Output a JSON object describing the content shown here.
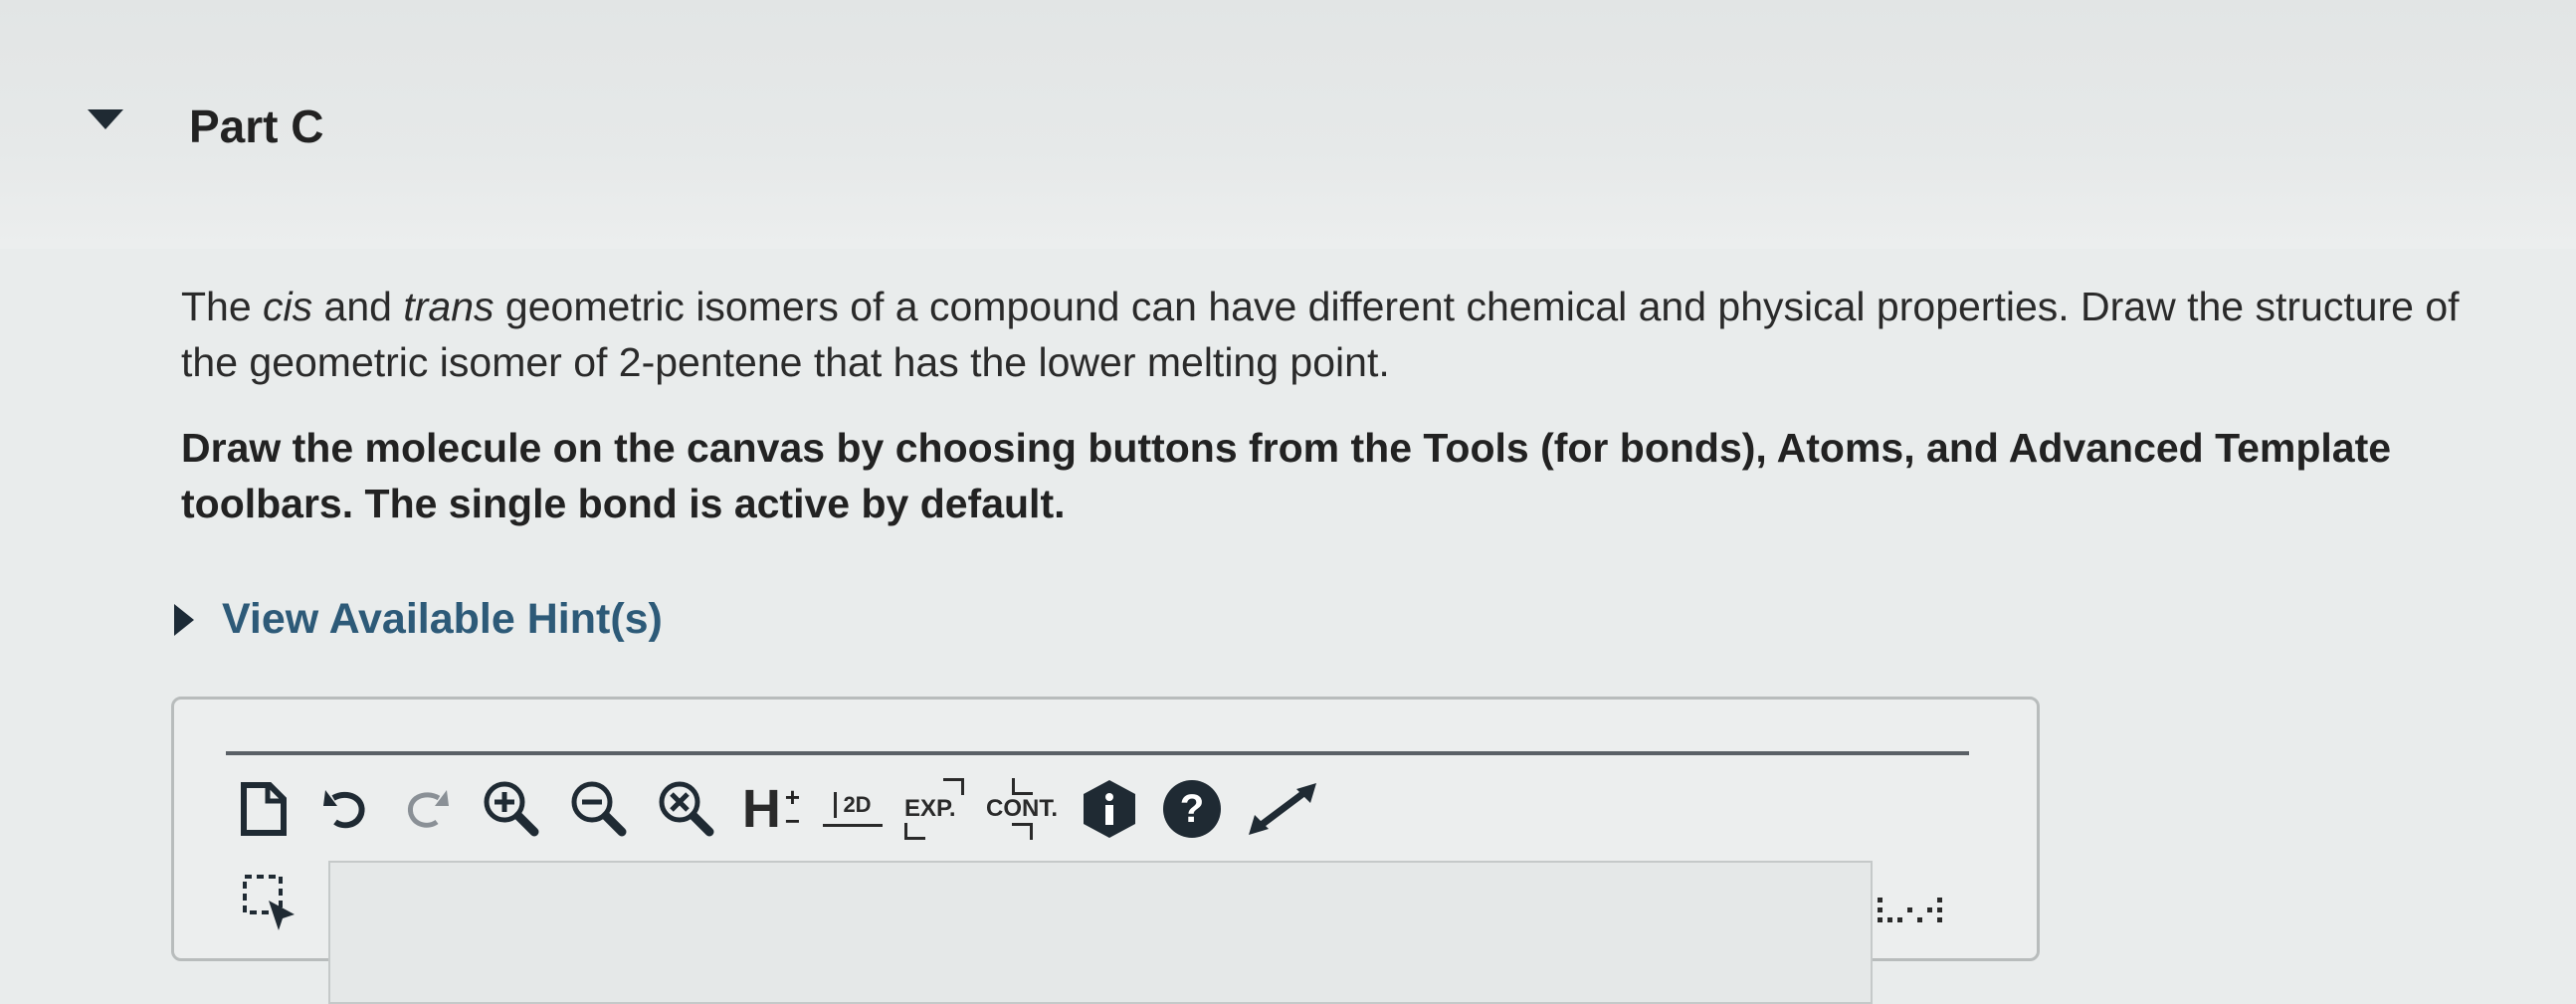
{
  "part": {
    "title": "Part C"
  },
  "question": {
    "p1": "The ",
    "cis": "cis",
    "p2": " and ",
    "trans": "trans",
    "p3": " geometric isomers of a compound can have different chemical and physical properties. Draw the structure of the geometric isomer of 2-pentene that has the lower melting point."
  },
  "instruction": "Draw the molecule on the canvas by choosing buttons from the Tools (for bonds), Atoms, and Advanced Template toolbars. The single bond is active by default.",
  "hint": {
    "label": "View Available Hint(s)"
  },
  "toolbar": {
    "clean_2d_label": "2D",
    "exp_label": "EXP.",
    "cont_label": "CONT.",
    "h_label": "H"
  },
  "icons": {
    "new": "new-document-icon",
    "undo": "undo-icon",
    "redo": "redo-icon",
    "zoom_in": "zoom-in-icon",
    "zoom_out": "zoom-out-icon",
    "reset_zoom": "reset-zoom-icon",
    "info": "info-icon",
    "help": "help-icon",
    "expand": "expand-icon"
  }
}
